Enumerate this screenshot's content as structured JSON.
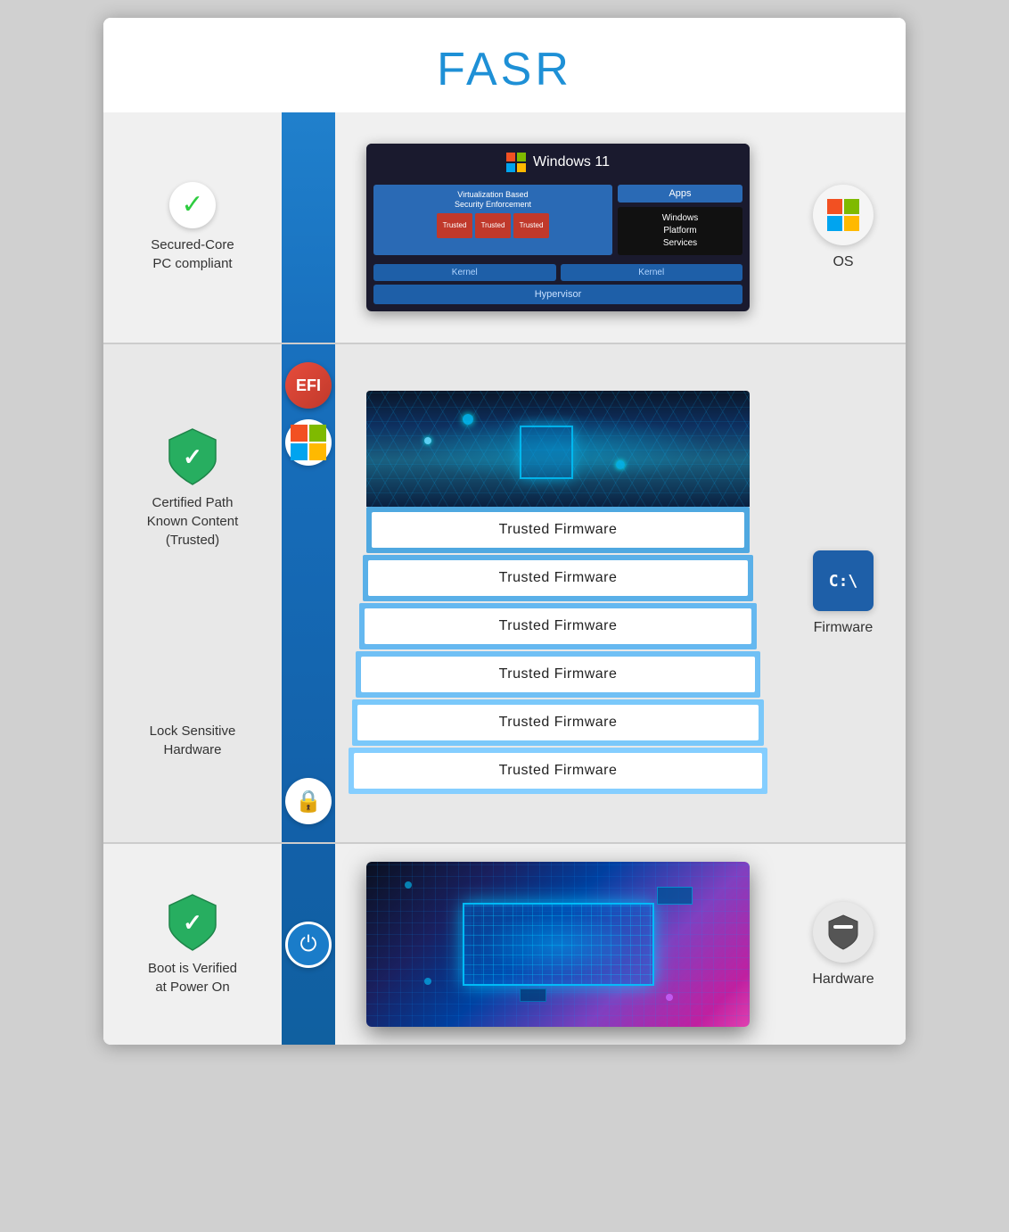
{
  "page": {
    "title": "FASR",
    "sections": {
      "os": {
        "left_label": "Secured-Core\nPC compliant",
        "right_label": "OS",
        "windows_title": "Windows 11",
        "vbs_label": "Virtualization Based\nSecurity Enforcement",
        "apps_label": "Apps",
        "wps_label": "Windows\nPlatform\nServices",
        "kernel_left": "Kernel",
        "kernel_right": "Kernel",
        "hypervisor": "Hypervisor"
      },
      "firmware": {
        "left_label": "Certified Path\nKnown Content\n(Trusted)",
        "lock_label": "Lock Sensitive\nHardware",
        "right_label": "Firmware",
        "layers": [
          "Trusted Firmware",
          "Trusted Firmware",
          "Trusted Firmware",
          "Trusted Firmware",
          "Trusted Firmware",
          "Trusted Firmware"
        ]
      },
      "hardware": {
        "left_label": "Boot is Verified\nat Power On",
        "right_label": "Hardware"
      }
    }
  }
}
